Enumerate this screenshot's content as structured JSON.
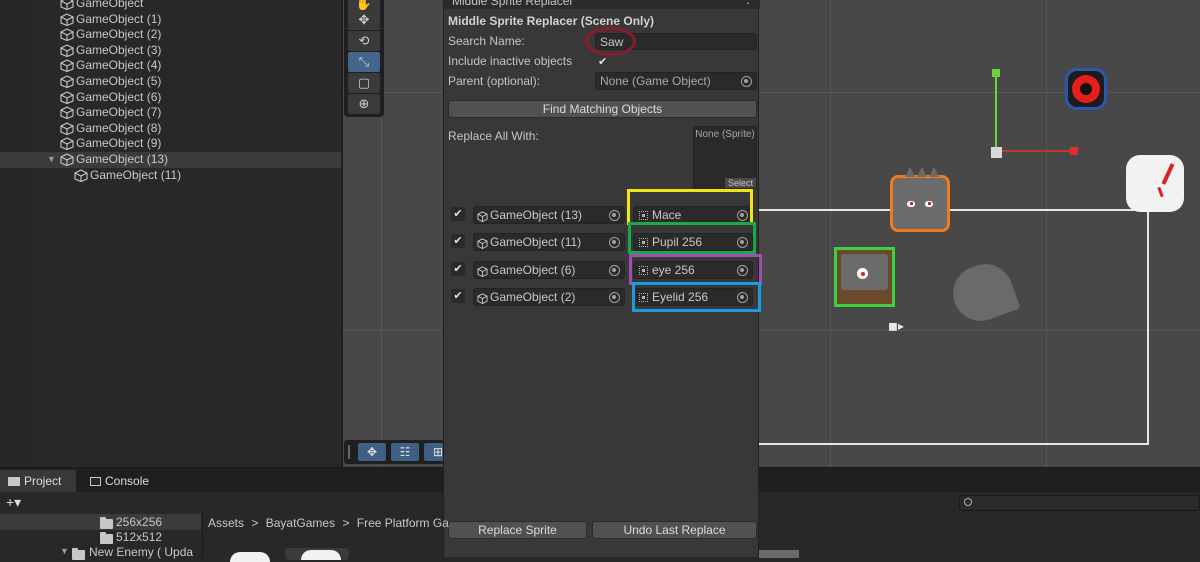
{
  "hierarchy": {
    "items": [
      {
        "label": "GameObject",
        "indent": 1
      },
      {
        "label": "GameObject (1)",
        "indent": 1
      },
      {
        "label": "GameObject (2)",
        "indent": 1
      },
      {
        "label": "GameObject (3)",
        "indent": 1
      },
      {
        "label": "GameObject (4)",
        "indent": 1
      },
      {
        "label": "GameObject (5)",
        "indent": 1
      },
      {
        "label": "GameObject (6)",
        "indent": 1
      },
      {
        "label": "GameObject (7)",
        "indent": 1
      },
      {
        "label": "GameObject (8)",
        "indent": 1
      },
      {
        "label": "GameObject (9)",
        "indent": 1
      },
      {
        "label": "GameObject (13)",
        "indent": 1,
        "selected": true,
        "expanded": true
      },
      {
        "label": "GameObject (11)",
        "indent": 2
      }
    ]
  },
  "panel": {
    "tab_label": "Middle Sprite Replacer",
    "header": "Middle Sprite Replacer (Scene Only)",
    "search_name_label": "Search Name:",
    "search_name_value": "Saw",
    "include_inactive_label": "Include inactive objects",
    "include_inactive_checked": "✔",
    "parent_label": "Parent (optional):",
    "parent_value": "None (Game Object)",
    "find_button": "Find Matching Objects",
    "replace_all_label": "Replace All With:",
    "sprite_slot_label": "None (Sprite)",
    "sprite_select_label": "Select",
    "rows": [
      {
        "checked": "✔",
        "object": "GameObject (13)",
        "sprite": "Mace",
        "highlight": "#f2e21b"
      },
      {
        "checked": "✔",
        "object": "GameObject (11)",
        "sprite": "Pupil 256",
        "highlight": "#1aa84a"
      },
      {
        "checked": "✔",
        "object": "GameObject (6)",
        "sprite": "eye 256",
        "highlight": "#a04fb0"
      },
      {
        "checked": "✔",
        "object": "GameObject (2)",
        "sprite": "Eyelid 256",
        "highlight": "#1a9ae0"
      }
    ],
    "search_highlight_color": "#8b1a2a",
    "replace_button": "Replace Sprite",
    "undo_button": "Undo Last Replace"
  },
  "project": {
    "tabs": [
      "Project",
      "Console"
    ],
    "add_label": "+▾",
    "folders": [
      {
        "label": "256x256"
      },
      {
        "label": "512x512"
      },
      {
        "label": "New Enemy ( Upda"
      }
    ],
    "breadcrumb": [
      "Assets",
      "BayatGames",
      "Free Platform Ga"
    ],
    "breadcrumb_sep": ">"
  },
  "colors": {
    "panel_bg": "#383838",
    "scene_bg": "#484848",
    "accent": "#44658c"
  }
}
